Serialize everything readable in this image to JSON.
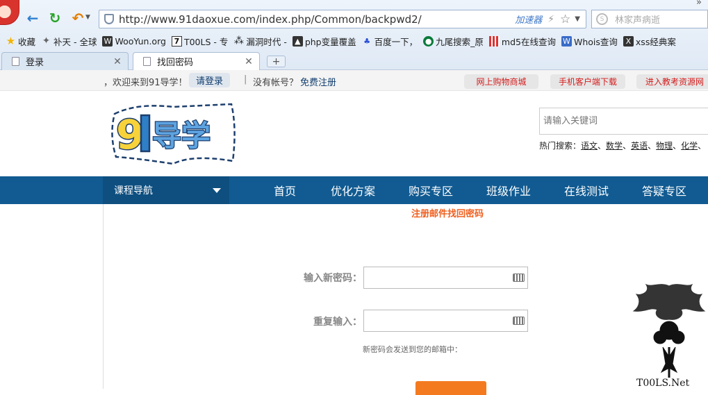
{
  "browser": {
    "url": "http://www.91daoxue.com/index.php/Common/backpwd2/",
    "accelerator_label": "加速器",
    "search_placeholder": "林家声病逝",
    "bookmarks": [
      {
        "label": "收藏",
        "icon": "star-icon"
      },
      {
        "label": "补天 - 全球",
        "icon": "butian-icon"
      },
      {
        "label": "WooYun.org",
        "icon": "wooyun-icon"
      },
      {
        "label": "T00LS - 专",
        "icon": "tools-icon"
      },
      {
        "label": "漏洞时代 -",
        "icon": "louddong-icon"
      },
      {
        "label": "php变量覆盖",
        "icon": "php-icon"
      },
      {
        "label": "百度一下，",
        "icon": "baidu-paw-icon"
      },
      {
        "label": "九尾搜索_原",
        "icon": "jiuwei-icon"
      },
      {
        "label": "md5在线查询",
        "icon": "md5-icon"
      },
      {
        "label": "Whois查询",
        "icon": "whois-icon"
      },
      {
        "label": "xss经典案",
        "icon": "xss-icon"
      }
    ],
    "tabs": [
      {
        "label": "登录"
      },
      {
        "label": "找回密码"
      }
    ],
    "new_tab_label": "+"
  },
  "topbar": {
    "welcome": "，欢迎来到91导学！",
    "login": "请登录",
    "separator": "|",
    "no_account": "没有帐号？",
    "register": "免费注册",
    "pills": [
      "网上购物商城",
      "手机客户端下载",
      "进入教考资源网"
    ]
  },
  "header": {
    "keyword_placeholder": "请输入关键词",
    "hot_label": "热门搜索：",
    "hot_terms": [
      "语文",
      "数学",
      "英语",
      "物理",
      "化学"
    ],
    "hot_sep": "、"
  },
  "navbar": {
    "course_nav": "课程导航",
    "items": [
      "首页",
      "优化方案",
      "购买专区",
      "班级作业",
      "在线测试",
      "答疑专区"
    ]
  },
  "form": {
    "title": "注册邮件找回密码",
    "new_password_label": "输入新密码：",
    "repeat_label": "重复输入：",
    "hint": "新密码会发送到您的邮箱中："
  },
  "watermark": {
    "text": "T00LS.Net"
  }
}
